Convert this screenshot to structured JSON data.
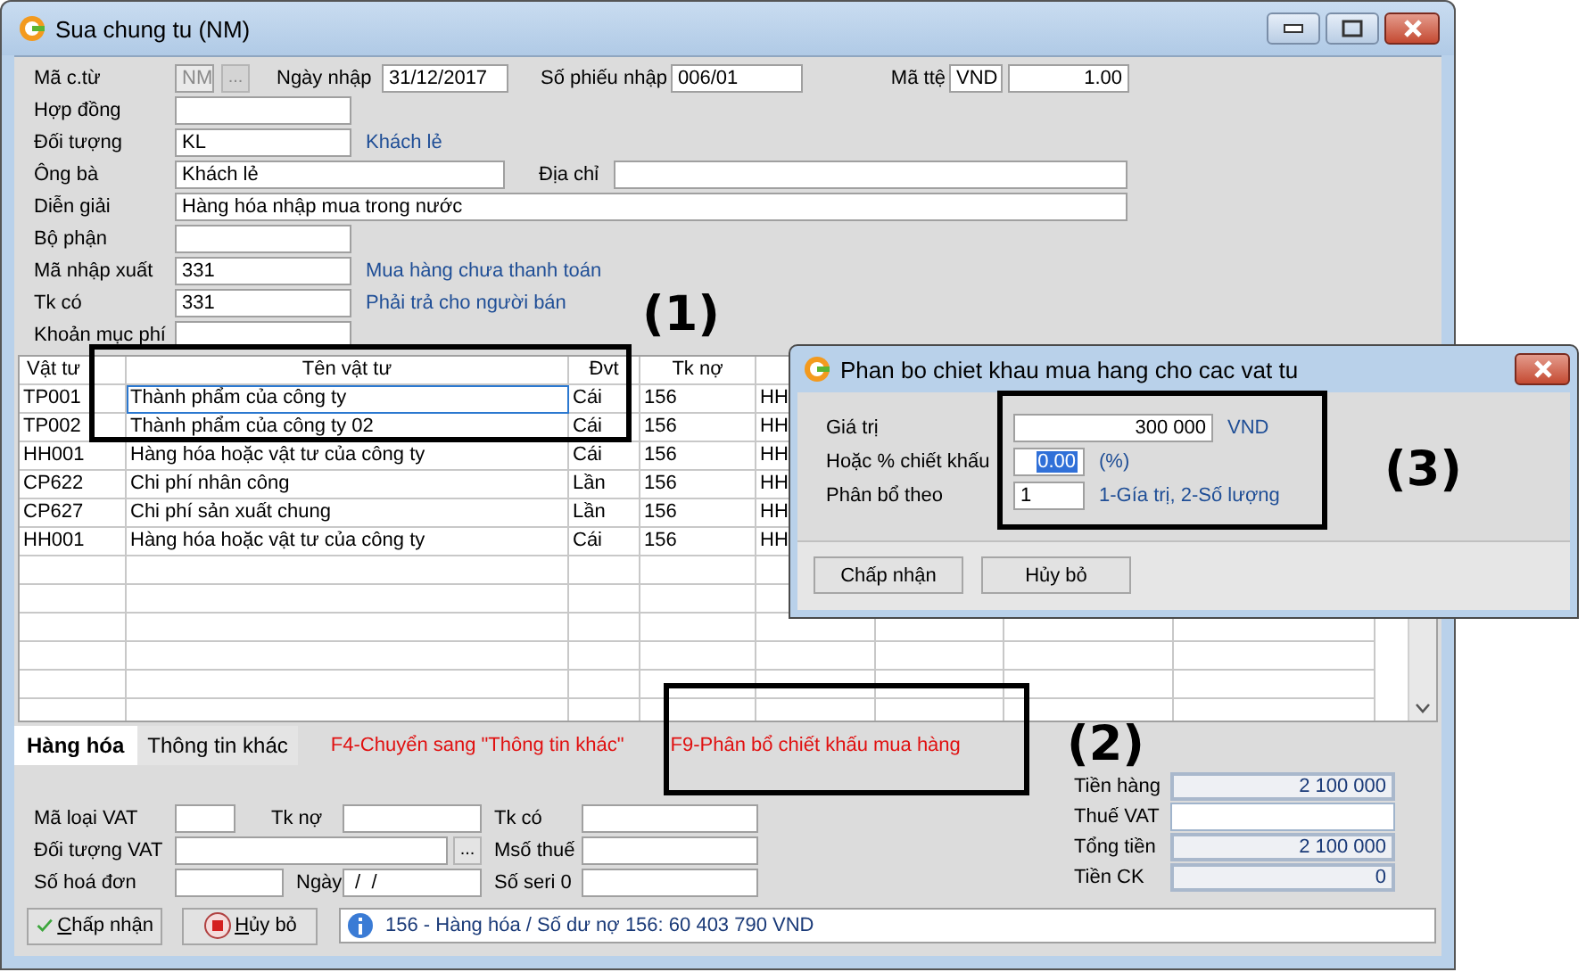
{
  "window": {
    "title": "Sua chung tu (NM)"
  },
  "form": {
    "ma_ctu": {
      "label": "Mã c.từ",
      "value": "NM",
      "disabled": true,
      "button": "..."
    },
    "ngay_nhap": {
      "label": "Ngày nhập",
      "value": "31/12/2017"
    },
    "so_phieu_nhap": {
      "label": "Số phiếu nhập",
      "value": "006/01"
    },
    "ma_tte": {
      "label": "Mã ttệ",
      "value": "VND",
      "rate": "1.00"
    },
    "hop_dong": {
      "label": "Hợp đồng"
    },
    "doi_tuong": {
      "label": "Đối tượng",
      "value": "KL",
      "note": "Khách lẻ"
    },
    "ong_ba": {
      "label": "Ông bà",
      "value": "Khách lẻ"
    },
    "dia_chi": {
      "label": "Địa chỉ"
    },
    "dien_giai": {
      "label": "Diễn giải",
      "value": "Hàng hóa nhập mua trong nước"
    },
    "bo_phan": {
      "label": "Bộ phận"
    },
    "ma_nhap_xuat": {
      "label": "Mã nhập xuất",
      "value": "331",
      "note": "Mua hàng chưa thanh toán"
    },
    "tk_co": {
      "label": "Tk có",
      "value": "331",
      "note": "Phải trả cho người bán"
    },
    "khoan_muc_phi": {
      "label": "Khoản mục phí"
    }
  },
  "table": {
    "columns": [
      "Vật tư",
      "Tên vật tư",
      "Đvt",
      "Tk nợ"
    ],
    "rows": [
      {
        "cells": [
          "TP001",
          "Thành phẩm của công ty",
          "Cái",
          "156",
          "HH"
        ],
        "selected": true
      },
      {
        "cells": [
          "TP002",
          "Thành phẩm của công ty 02",
          "Cái",
          "156",
          "HH"
        ],
        "selected": false
      },
      {
        "cells": [
          "HH001",
          "Hàng hóa hoặc vật tư của công ty",
          "Cái",
          "156",
          "HH"
        ],
        "selected": false
      },
      {
        "cells": [
          "CP622",
          "Chi phí nhân công",
          "Lần",
          "156",
          "HH"
        ],
        "selected": false
      },
      {
        "cells": [
          "CP627",
          "Chi phí sản xuất chung",
          "Lần",
          "156",
          "HH"
        ],
        "selected": false
      },
      {
        "cells": [
          "HH001",
          "Hàng hóa hoặc vật tư của công ty",
          "Cái",
          "156",
          "HH"
        ],
        "selected": false
      }
    ]
  },
  "tabs": [
    {
      "label": "Hàng hóa",
      "selected": true
    },
    {
      "label": "Thông tin khác",
      "selected": false
    }
  ],
  "hints": [
    "F4-Chuyển sang \"Thông tin khác\"",
    "F9-Phân bổ chiết khấu mua hàng"
  ],
  "vat": {
    "ma_loai_vat": {
      "label": "Mã loại VAT"
    },
    "tk_no": {
      "label": "Tk nợ"
    },
    "tk_co": {
      "label": "Tk có"
    },
    "doi_tuong_vat": {
      "label": "Đối tượng VAT",
      "button": "..."
    },
    "mso_thue": {
      "label": "Msố thuế"
    },
    "so_hoa_don": {
      "label": "Số hoá đơn"
    },
    "ngay": {
      "label": "Ngày",
      "value": " /  /"
    },
    "so_seri": {
      "label": "Số seri 0"
    }
  },
  "totals": [
    {
      "label": "Tiền hàng",
      "value": "2 100 000",
      "readonly": true
    },
    {
      "label": "Thuế VAT",
      "readonly": false
    },
    {
      "label": "Tổng tiền",
      "value": "2 100 000",
      "readonly": true
    },
    {
      "label": "Tiền CK",
      "value": "0",
      "readonly": true
    }
  ],
  "buttons": [
    {
      "label": "Chấp nhận",
      "kind": "accept"
    },
    {
      "label": "Hủy bỏ",
      "kind": "cancel"
    }
  ],
  "status_bar": "156 - Hàng hóa / Số dư nợ 156: 60 403 790 VND",
  "dialog": {
    "title": "Phan bo chiet khau mua hang cho cac vat tu",
    "fields": [
      {
        "label": "Giá trị",
        "value": "300 000",
        "unit": "VND",
        "selected": false
      },
      {
        "label": "Hoặc % chiết khấu",
        "value": "0.00",
        "unit": "(%)",
        "selected": true
      },
      {
        "label": "Phân bổ theo",
        "value": "1",
        "unit": "1-Gía trị,   2-Số lượng",
        "selected": false
      }
    ],
    "buttons": [
      "Chấp nhận",
      "Hủy bỏ"
    ]
  },
  "annotations": [
    "(1)",
    "(2)",
    "(3)"
  ]
}
